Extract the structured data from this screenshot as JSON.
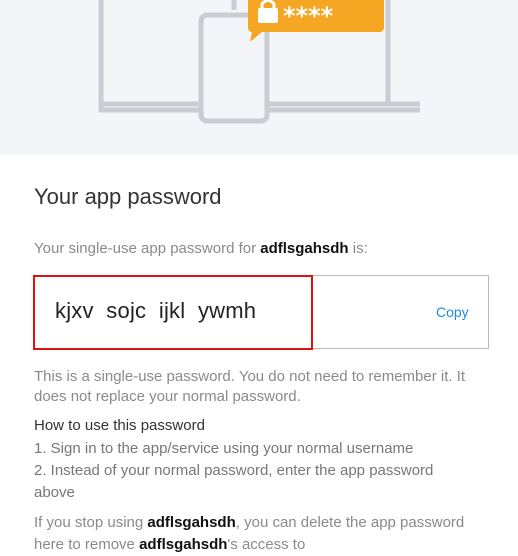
{
  "hero": {
    "badge_text": "****",
    "colors": {
      "background": "#f3f5f8",
      "outline": "#c9cdd3",
      "badge": "#f5a623"
    },
    "icons": [
      "laptop-icon",
      "phone-icon",
      "lock-icon"
    ]
  },
  "title": "Your app password",
  "intro": {
    "prefix": "Your single-use app password for ",
    "account": "adflsgahsdh",
    "suffix": " is:"
  },
  "password": {
    "value": "kjxv  sojc  ijkl  ywmh",
    "copy_label": "Copy"
  },
  "note": "This is a single-use password. You do not need to remember it. It does not replace your normal password.",
  "howto": {
    "title": "How to use this password",
    "steps": [
      "1. Sign in to the app/service using your normal username",
      "2. Instead of your normal password, enter the app password above"
    ]
  },
  "stop": {
    "part1": "If you stop using ",
    "account": "adflsgahsdh",
    "part2": ", you can delete the app password here to remove ",
    "account2": "adflsgahsdh",
    "part3": "'s access to"
  },
  "colors": {
    "accent": "#1b8fd6",
    "highlight": "#e01010"
  }
}
